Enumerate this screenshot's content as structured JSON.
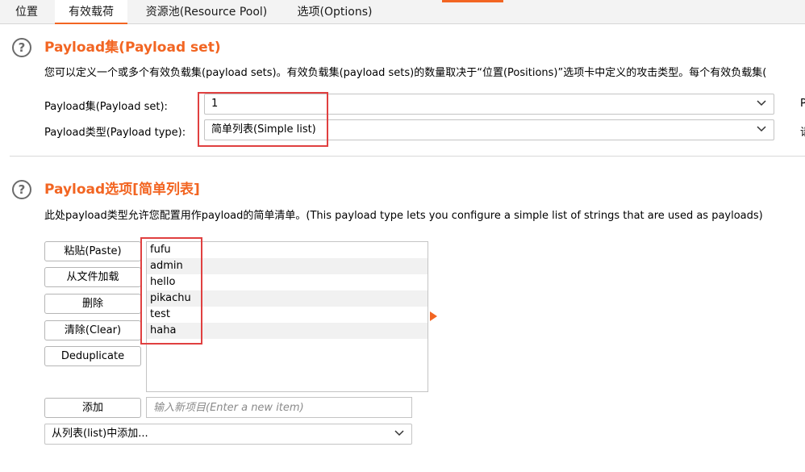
{
  "tabs": [
    {
      "label": "位置"
    },
    {
      "label": "有效载荷"
    },
    {
      "label": "资源池(Resource Pool)"
    },
    {
      "label": "选项(Options)"
    }
  ],
  "payload_set_section": {
    "title": "Payload集(Payload set)",
    "description": "您可以定义一个或多个有效负载集(payload sets)。有效负载集(payload sets)的数量取决于“位置(Positions)”选项卡中定义的攻击类型。每个有效负载集(",
    "set_label": "Payload集(Payload set):",
    "set_value": "1",
    "type_label": "Payload类型(Payload type):",
    "type_value": "简单列表(Simple list)",
    "clipped_right_1": "P",
    "clipped_right_2": "请"
  },
  "payload_options_section": {
    "title": "Payload选项[简单列表]",
    "description": "此处payload类型允许您配置用作payload的简单清单。(This payload type lets you configure a simple list of strings that are used as payloads)"
  },
  "buttons": {
    "paste": "粘贴(Paste)",
    "load": "从文件加载",
    "remove": "删除",
    "clear": "清除(Clear)",
    "deduplicate": "Deduplicate",
    "add": "添加"
  },
  "payload_items": [
    "fufu",
    "admin",
    "hello",
    "pikachu",
    "test",
    "haha"
  ],
  "new_item_placeholder": "输入新项目(Enter a new item)",
  "add_from_list_value": "从列表(list)中添加...",
  "colors": {
    "accent": "#f26522",
    "highlight_box": "#e04040"
  }
}
